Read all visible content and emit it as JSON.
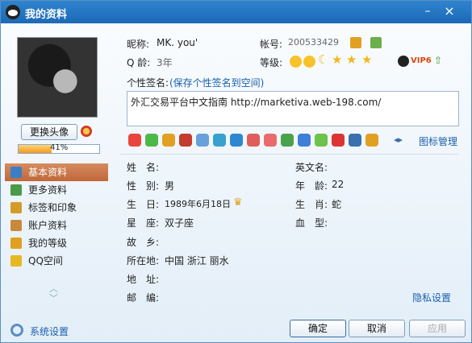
{
  "window": {
    "title": "我的资料",
    "min_glyph": "–",
    "close_glyph": "×"
  },
  "profile": {
    "change_avatar": "更换头像",
    "progress_percent": 41,
    "progress_label": "41%"
  },
  "nav": {
    "items": [
      {
        "label": "基本资料",
        "icon": "profile-card-icon",
        "color": "#3a7fc5"
      },
      {
        "label": "更多资料",
        "icon": "more-info-icon",
        "color": "#4a9a4a"
      },
      {
        "label": "标签和印象",
        "icon": "tag-icon",
        "color": "#d59a2a"
      },
      {
        "label": "账户资料",
        "icon": "account-icon",
        "color": "#c78a3a"
      },
      {
        "label": "我的等级",
        "icon": "level-icon",
        "color": "#e0a020"
      },
      {
        "label": "QQ空间",
        "icon": "qzone-icon",
        "color": "#e6b822"
      }
    ],
    "arrow_up": "︿",
    "arrow_down": "﹀"
  },
  "settings_label": "系统设置",
  "header": {
    "nickname_label": "昵称:",
    "nickname": "MK.  you'",
    "account_label": "帐号:",
    "account": "200533429",
    "qage_label": "Q 龄:",
    "qage": "3年",
    "level_label": "等级:",
    "vip_text": "VIP6",
    "signature_label": "个性签名:",
    "signature_link": "(保存个性签名到空间)"
  },
  "signature": "外汇交易平台中文指南 http://marketiva.web-198.com/",
  "icon_manage": "图标管理",
  "icon_colors": [
    "#e8463c",
    "#4cb848",
    "#e2a023",
    "#c43b2f",
    "#6aa0d8",
    "#39a0d0",
    "#2e88d1",
    "#e05d5d",
    "#e96b6b",
    "#4aa24a",
    "#3f7fd8",
    "#6cc24a",
    "#d33",
    "#3a6fb0",
    "#e2a023"
  ],
  "fields": {
    "name_label": "姓　名:",
    "name": "",
    "english_name_label": "英文名:",
    "english_name": "",
    "gender_label": "性　别:",
    "gender": "男",
    "age_label": "年　龄:",
    "age": "22",
    "birthday_label": "生　日:",
    "birthday": "1989年6月18日",
    "zodiac_label": "生　肖:",
    "zodiac": "蛇",
    "constellation_label": "星　座:",
    "constellation": "双子座",
    "blood_label": "血　型:",
    "blood": "",
    "hometown_label": "故　乡:",
    "hometown": "",
    "location_label": "所在地:",
    "location": "中国  浙江  丽水",
    "address_label": "地　址:",
    "address": "",
    "zipcode_label": "邮　编:",
    "zipcode": ""
  },
  "privacy": "隐私设置",
  "buttons": {
    "ok": "确定",
    "cancel": "取消",
    "apply": "应用"
  }
}
